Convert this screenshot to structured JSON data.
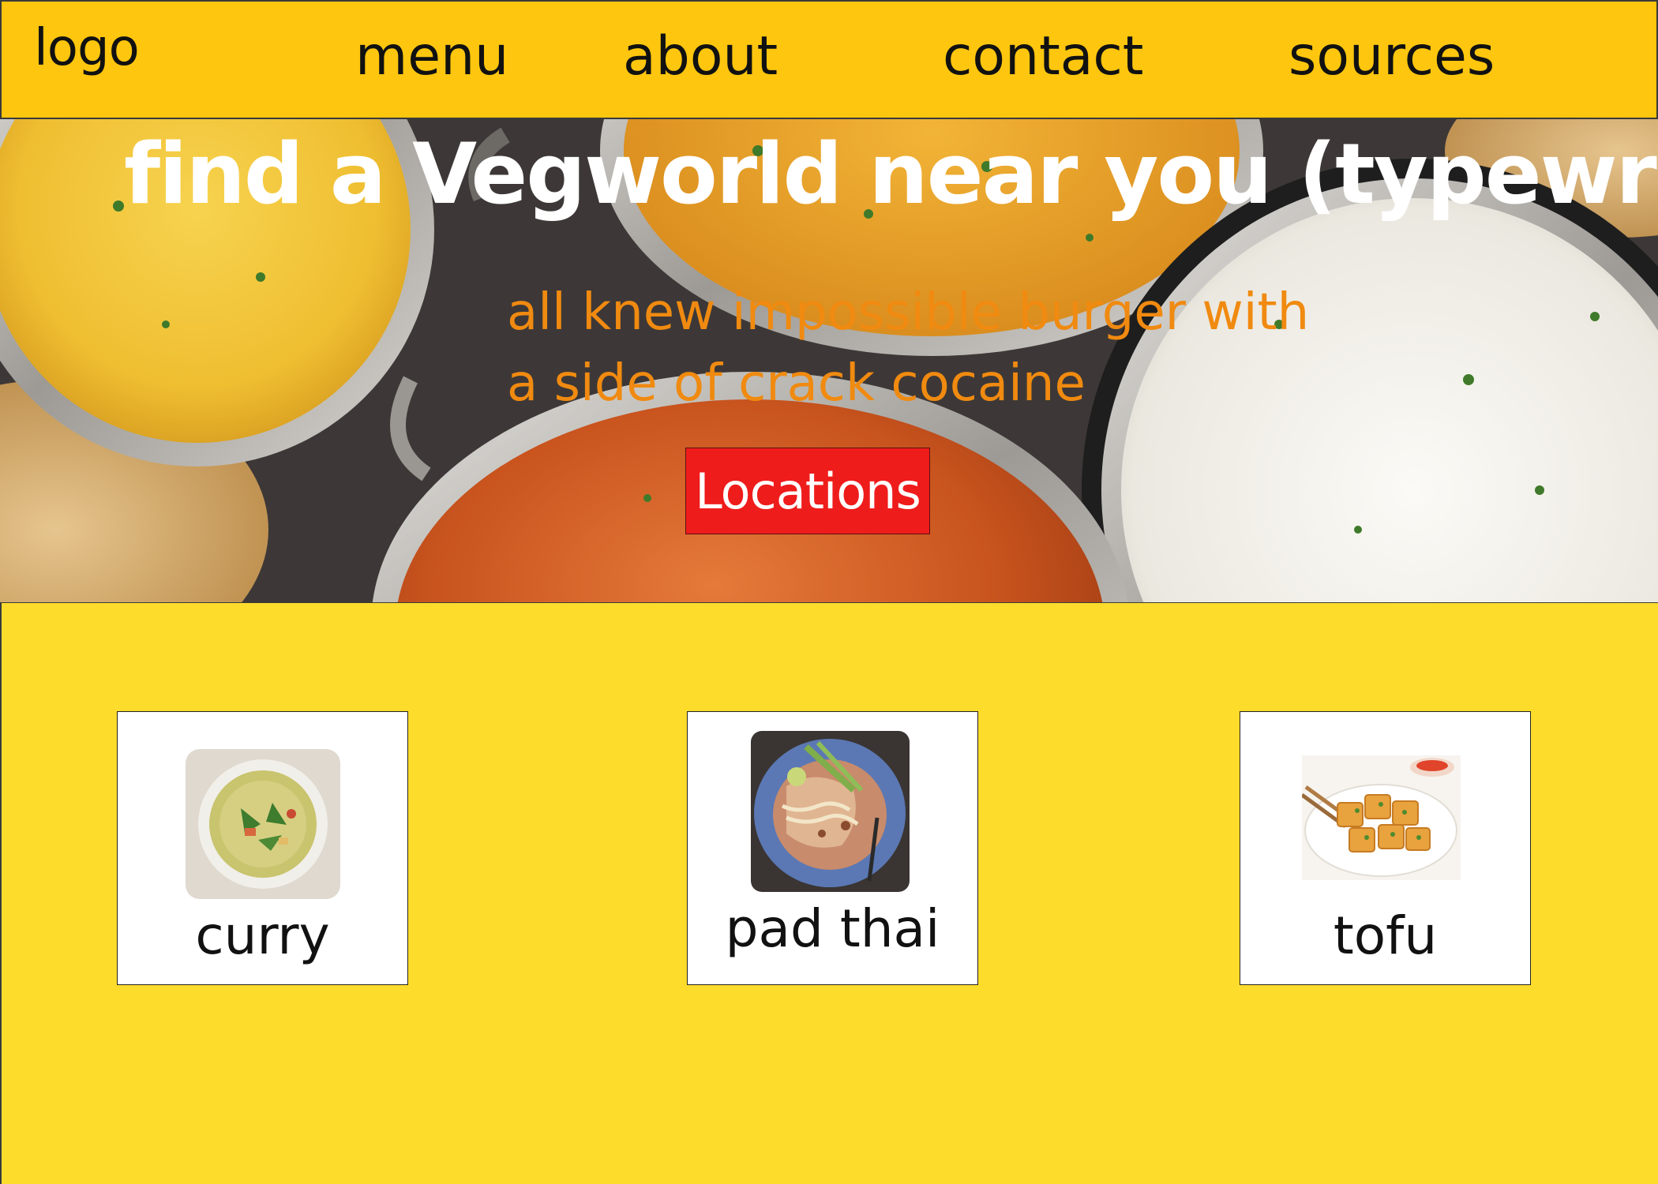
{
  "nav": {
    "logo": "logo",
    "links": [
      "menu",
      "about",
      "contact",
      "sources"
    ]
  },
  "hero": {
    "title": "find a Vegworld near you (typewriter)",
    "tagline_line1": "all knew impossible burger with",
    "tagline_line2": "a side of crack cocaine",
    "cta_label": "Locations"
  },
  "dishes": [
    {
      "name": "curry",
      "image_icon": "curry-bowl-icon"
    },
    {
      "name": "pad thai",
      "image_icon": "pad-thai-plate-icon"
    },
    {
      "name": "tofu",
      "image_icon": "tofu-plate-icon"
    }
  ],
  "colors": {
    "navbar": "#fec60e",
    "section": "#fedc2c",
    "cta": "#ef1c1c",
    "tagline": "#f08a10",
    "title": "#ffffff"
  }
}
